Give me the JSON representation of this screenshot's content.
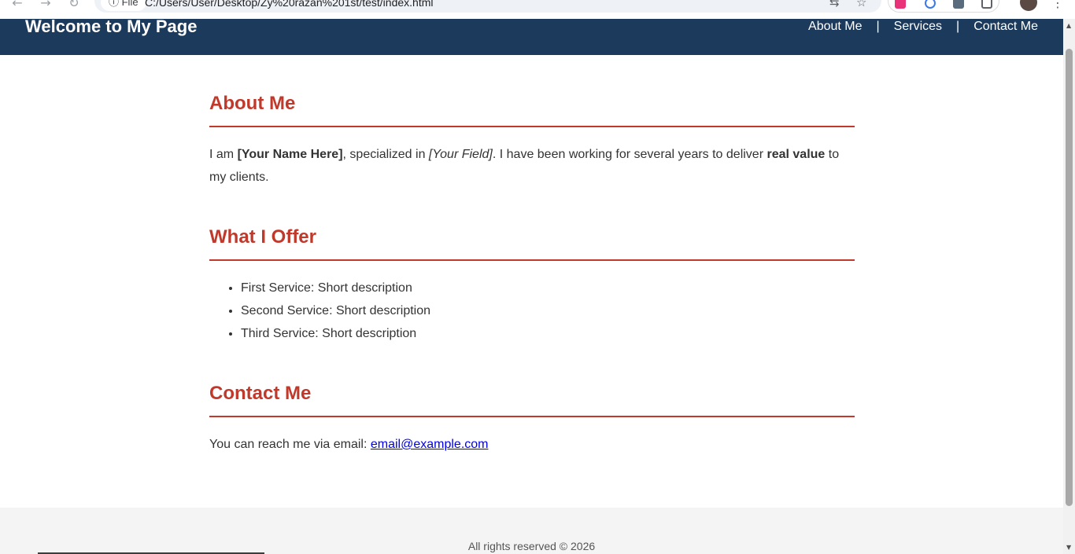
{
  "browser": {
    "back_icon": "←",
    "forward_icon": "→",
    "reload_icon": "↻",
    "file_chip": "ⓘ File",
    "url": "C:/Users/User/Desktop/Zy%20razan%201st/test/index.html",
    "translate_icon": "⇆",
    "star_icon": "☆",
    "menu_icon": "⋮"
  },
  "header": {
    "title": "Welcome to My Page",
    "nav": {
      "about": "About Me",
      "services": "Services",
      "contact": "Contact Me",
      "separator": "|"
    }
  },
  "about": {
    "heading": "About Me",
    "text_1": "I am ",
    "name": "[Your Name Here]",
    "text_2": ", specialized in ",
    "field": "[Your Field]",
    "text_3": ". I have been working for several years to deliver ",
    "highlight": "real value",
    "text_4": " to my clients."
  },
  "offer": {
    "heading": "What I Offer",
    "items": [
      "First Service: Short description",
      "Second Service: Short description",
      "Third Service: Short description"
    ]
  },
  "contact": {
    "heading": "Contact Me",
    "text": "You can reach me via email: ",
    "email": "email@example.com"
  },
  "footer": {
    "text": "All rights reserved © 2026"
  },
  "colors": {
    "header_bg": "#1b3a5c",
    "accent": "#c0392b",
    "link": "#0000ee",
    "footer_bg": "#f4f4f4"
  }
}
